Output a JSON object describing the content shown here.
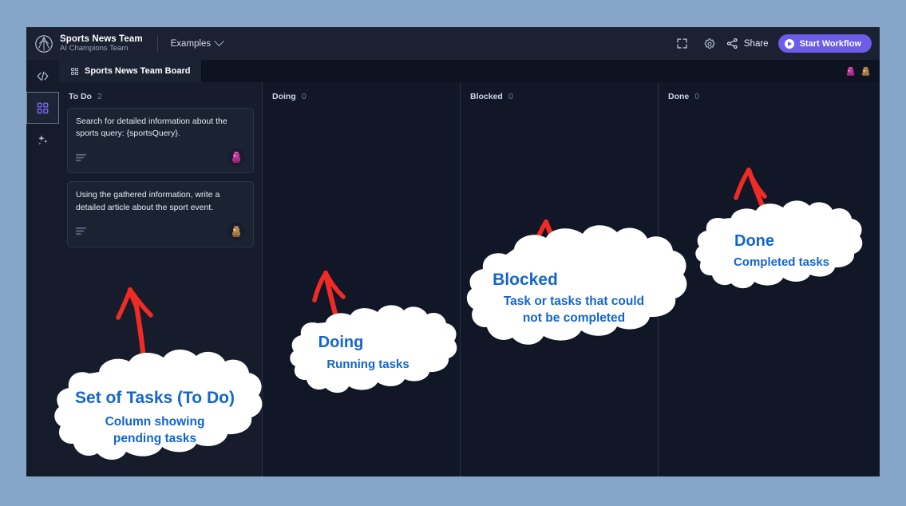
{
  "colors": {
    "page_bg": "#85a6c8",
    "app_bg": "#111727",
    "topbar_bg": "#1b2132",
    "accent_purple": "#6c5ce7",
    "annotation_blue": "#1266cc",
    "arrow_red": "#ef2b24",
    "card_bg": "#1b2232"
  },
  "topbar": {
    "logo_icon": "team-crest-icon",
    "brand_title": "Sports News Team",
    "brand_subtitle": "AI Champions Team",
    "examples_label": "Examples",
    "examples_caret_icon": "chevron-down-icon",
    "expand_icon": "expand-fullscreen-icon",
    "settings_icon": "gear-icon",
    "share_icon": "share-icon",
    "share_label": "Share",
    "start_icon": "play-icon",
    "start_label": "Start Workflow"
  },
  "rail": {
    "items": [
      {
        "icon": "code-brackets-icon",
        "name": "code",
        "active": false
      },
      {
        "icon": "grid-squares-icon",
        "name": "board",
        "active": true
      },
      {
        "icon": "sparkles-icon",
        "name": "assistant",
        "active": false
      }
    ]
  },
  "tabstrip": {
    "tab_icon": "grid-squares-icon",
    "tab_label": "Sports News Team  Board",
    "avatars": [
      {
        "name": "avatar-pink",
        "color": "#c0389a"
      },
      {
        "name": "avatar-tan",
        "color": "#b98a55"
      }
    ]
  },
  "board": {
    "columns": [
      {
        "title": "To Do",
        "count": "2",
        "cards": [
          {
            "text": "Search for detailed information about the sports query: {sportsQuery}.",
            "desc_icon": "description-lines-icon",
            "avatar": {
              "name": "avatar-pink",
              "color": "#c0389a"
            }
          },
          {
            "text": "Using the gathered information, write a detailed article about the sport event.",
            "desc_icon": "description-lines-icon",
            "avatar": {
              "name": "avatar-tan",
              "color": "#b98a55"
            }
          }
        ]
      },
      {
        "title": "Doing",
        "count": "0",
        "cards": []
      },
      {
        "title": "Blocked",
        "count": "0",
        "cards": []
      },
      {
        "title": "Done",
        "count": "0",
        "cards": []
      }
    ]
  },
  "annotations": [
    {
      "name": "callout-todo",
      "title": "Set of Tasks (To Do)",
      "subtitle_line1": "Column showing",
      "subtitle_line2": "pending tasks"
    },
    {
      "name": "callout-doing",
      "title": "Doing",
      "subtitle_line1": "Running tasks",
      "subtitle_line2": ""
    },
    {
      "name": "callout-blocked",
      "title": "Blocked",
      "subtitle_line1": "Task or tasks that could",
      "subtitle_line2": "not be completed"
    },
    {
      "name": "callout-done",
      "title": "Done",
      "subtitle_line1": "Completed tasks",
      "subtitle_line2": ""
    }
  ]
}
